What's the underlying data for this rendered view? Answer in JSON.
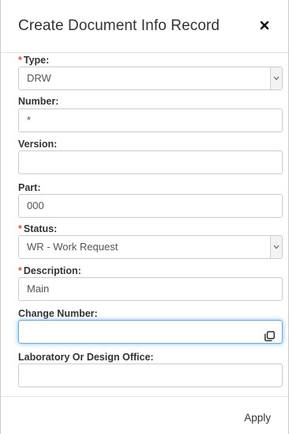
{
  "dialog": {
    "title": "Create Document Info Record",
    "close_icon": "close-icon"
  },
  "fields": {
    "type": {
      "required_mark": "*",
      "label": "Type:",
      "value": "DRW",
      "control": "select"
    },
    "number": {
      "label": "Number:",
      "value": "*"
    },
    "version": {
      "label": "Version:",
      "value": ""
    },
    "part": {
      "label": "Part:",
      "value": "000"
    },
    "status": {
      "required_mark": "*",
      "label": "Status:",
      "value": "WR - Work Request",
      "control": "select"
    },
    "description": {
      "required_mark": "*",
      "label": "Description:",
      "value": "Main"
    },
    "change_number": {
      "label": "Change Number:",
      "value": "",
      "icon": "lookup-icon",
      "focused": true
    },
    "lab_office": {
      "label": "Laboratory Or Design Office:",
      "value": ""
    }
  },
  "footer": {
    "apply_label": "Apply"
  },
  "colors": {
    "required": "#d9534f",
    "focus_border": "#66afe9"
  }
}
